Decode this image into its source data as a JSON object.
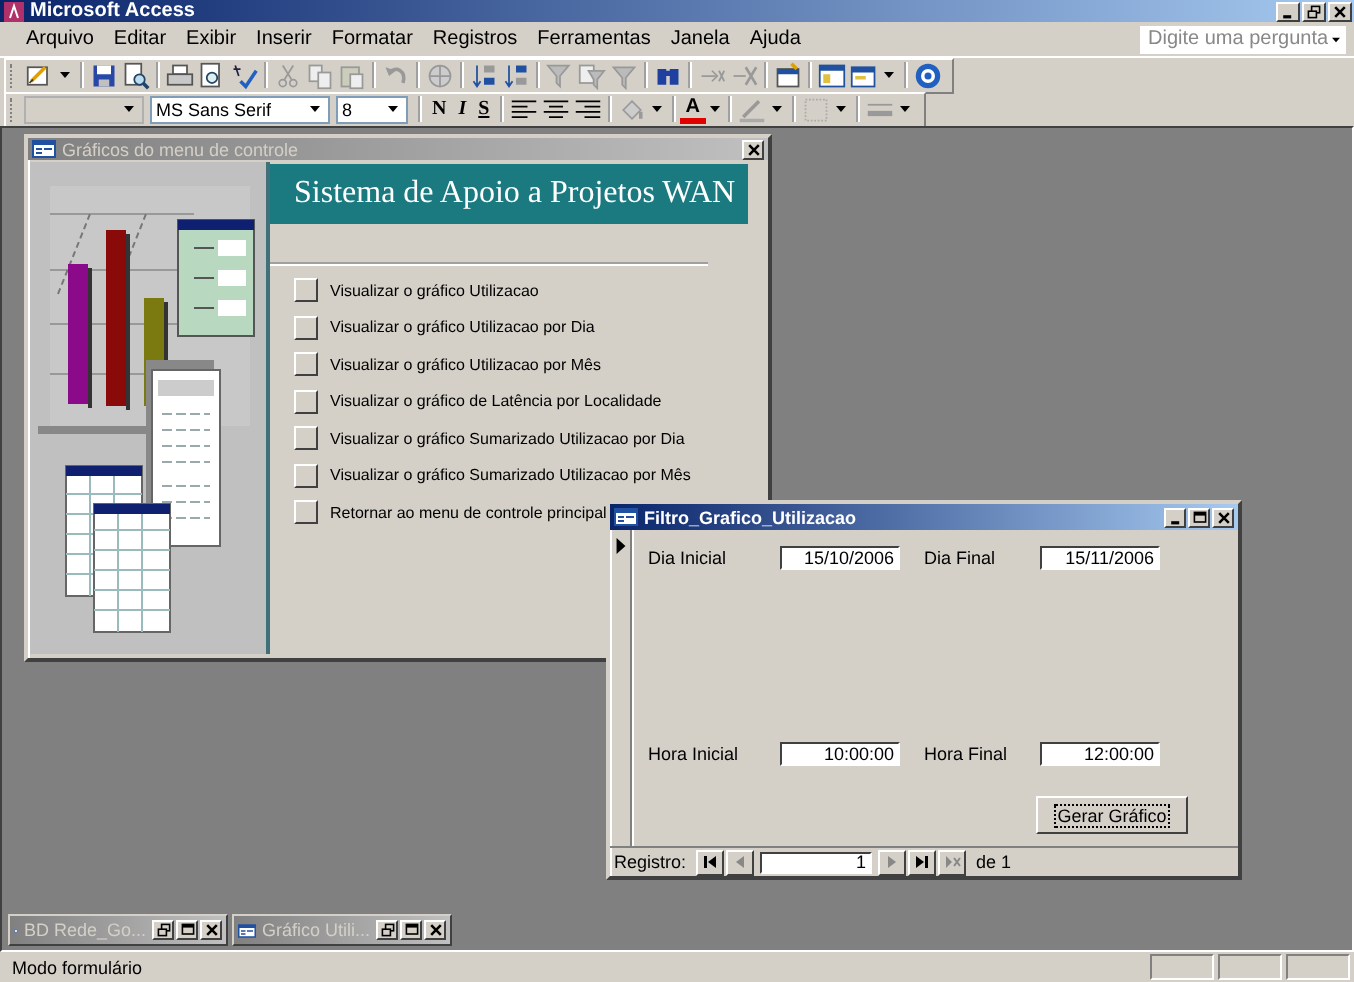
{
  "app": {
    "title": "Microsoft Access",
    "menu": [
      "Arquivo",
      "Editar",
      "Exibir",
      "Inserir",
      "Formatar",
      "Registros",
      "Ferramentas",
      "Janela",
      "Ajuda"
    ],
    "help_search": {
      "placeholder": "Digite uma pergunta"
    },
    "format_toolbar": {
      "font": "MS Sans Serif",
      "size": "8",
      "text_buttons": [
        "N",
        "I",
        "S"
      ],
      "font_color_button": "A"
    }
  },
  "switchboard": {
    "title": "Gráficos do menu de controle",
    "active": false,
    "heading": "Sistema de Apoio a Projetos WAN",
    "items": [
      {
        "label": "Visualizar o gráfico Utilizacao"
      },
      {
        "label": "Visualizar o gráfico Utilizacao por Dia"
      },
      {
        "label": "Visualizar o gráfico Utilizacao por Mês"
      },
      {
        "label": "Visualizar o gráfico de Latência por Localidade"
      },
      {
        "label": "Visualizar o gráfico Sumarizado Utilizacao por Dia"
      },
      {
        "label": "Visualizar o gráfico Sumarizado Utilizacao por Mês"
      },
      {
        "label": "Retornar ao menu de controle principal"
      }
    ]
  },
  "filter_form": {
    "title": "Filtro_Grafico_Utilizacao",
    "active": true,
    "fields": [
      {
        "label": "Dia Inicial",
        "value": "15/10/2006"
      },
      {
        "label": "Dia Final",
        "value": "15/11/2006"
      },
      {
        "label": "Hora Inicial",
        "value": "10:00:00"
      },
      {
        "label": "Hora Final",
        "value": "12:00:00"
      }
    ],
    "button": "Gerar Gráfico",
    "navigation": {
      "label": "Registro:",
      "current": "1",
      "of_label": "de",
      "total": "1"
    }
  },
  "minimized": [
    {
      "title": "BD Rede_Go..."
    },
    {
      "title": "Gráfico Utili..."
    }
  ],
  "status_bar": {
    "text": "Modo formulário"
  }
}
